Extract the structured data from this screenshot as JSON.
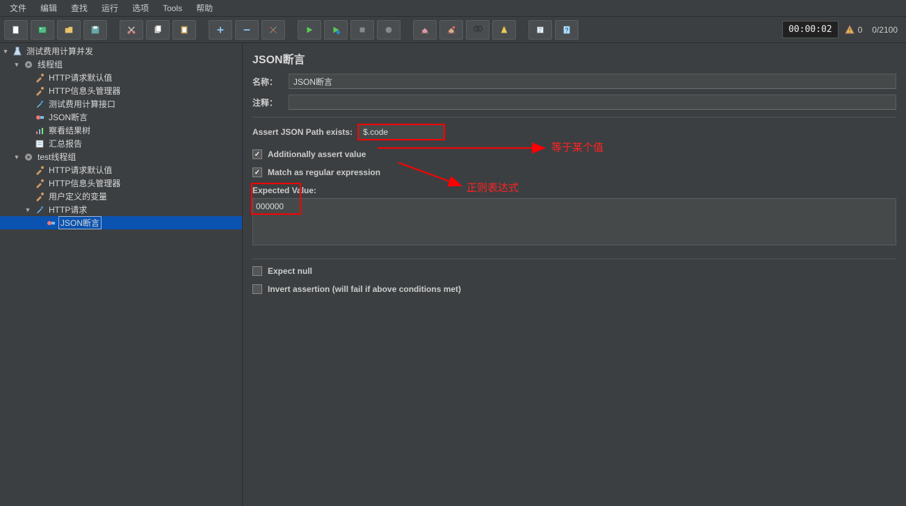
{
  "menu": {
    "file": "文件",
    "edit": "编辑",
    "search": "查找",
    "run": "运行",
    "options": "选项",
    "tools": "Tools",
    "help": "帮助"
  },
  "status": {
    "timer": "00:00:02",
    "warnings": "0",
    "counter": "0/2100"
  },
  "tree": {
    "n0": "测试费用计算并发",
    "n1": "线程组",
    "n1a": "HTTP请求默认值",
    "n1b": "HTTP信息头管理器",
    "n1c": "测试费用计算接口",
    "n1d": "JSON断言",
    "n1e": "察看结果树",
    "n1f": "汇总报告",
    "n2": "test线程组",
    "n2a": "HTTP请求默认值",
    "n2b": "HTTP信息头管理器",
    "n2c": "用户定义的变量",
    "n2d": "HTTP请求",
    "n2d1": "JSON断言"
  },
  "panel": {
    "title": "JSON断言",
    "name_label": "名称：",
    "name_value": "JSON断言",
    "comment_label": "注释：",
    "comment_value": "",
    "assert_path_label": "Assert JSON Path exists:",
    "assert_path_value": "$.code",
    "chk_assert_value": "Additionally assert value",
    "chk_regex": "Match as regular expression",
    "expected_label": "Expected Value:",
    "expected_value": "000000",
    "chk_null": "Expect null",
    "chk_invert": "Invert assertion (will fail if above conditions met)"
  },
  "annotations": {
    "a1": "等于某个值",
    "a2": "正则表达式"
  }
}
